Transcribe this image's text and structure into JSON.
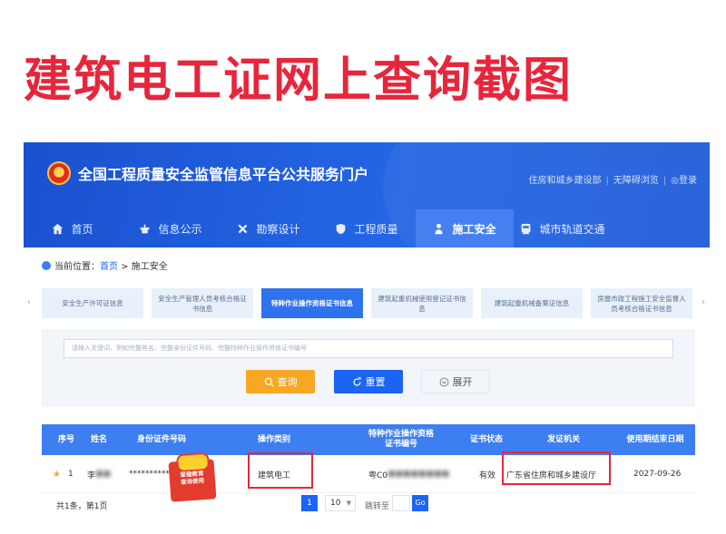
{
  "headline": "建筑电工证网上查询截图",
  "portal": {
    "title": "全国工程质量安全监管信息平台公共服务门户",
    "top_links": [
      "住房和城乡建设部",
      "无障碍浏览",
      "登录"
    ]
  },
  "nav": [
    {
      "label": "首页",
      "icon": "home-icon"
    },
    {
      "label": "信息公示",
      "icon": "notice-icon"
    },
    {
      "label": "勘察设计",
      "icon": "tools-icon"
    },
    {
      "label": "工程质量",
      "icon": "shield-icon"
    },
    {
      "label": "施工安全",
      "icon": "worker-icon",
      "active": true
    },
    {
      "label": "城市轨道交通",
      "icon": "train-icon"
    }
  ],
  "breadcrumb": {
    "prefix": "当前位置：",
    "home": "首页",
    "sep": " > ",
    "current": "施工安全"
  },
  "categories": [
    "安全生产许可证信息",
    "安全生产管理人员考核合格证书信息",
    "特种作业操作资格证书信息",
    "建筑起重机械使用登记证书信息",
    "建筑起重机械备案证信息",
    "房屋市政工程施工安全监督人员考核合格证书信息"
  ],
  "search": {
    "placeholder": "请输入关键词，例如完整姓名、完整身份证件号码、完整特种作业操作资格证书编号",
    "query": "查询",
    "reset": "重置",
    "expand": "展开"
  },
  "table": {
    "headers": [
      "序号",
      "姓名",
      "身份证件号码",
      "操作类别",
      "特种作业操作资格证书编号",
      "证书状态",
      "发证机关",
      "使用期结束日期"
    ],
    "row": {
      "no": "1",
      "name": "李",
      "name_masked": "■■",
      "id_number": "***********",
      "category": "建筑电工",
      "cert_prefix": "粤C0",
      "cert_masked": "■■■■■■■■",
      "status": "有效",
      "issuer": "广东省住房和城乡建设厅",
      "end_date": "2027-09-26"
    }
  },
  "sticker": [
    "爱建教育",
    "查询使用"
  ],
  "pager": {
    "total": "共1条，第1页",
    "page": "1",
    "size": "10",
    "jump": "跳转至",
    "go": "Go"
  },
  "colors": {
    "headline": "#e6263c",
    "banner": "#1f5bd8",
    "accent": "#1c64f2",
    "query_button": "#f7a823"
  }
}
